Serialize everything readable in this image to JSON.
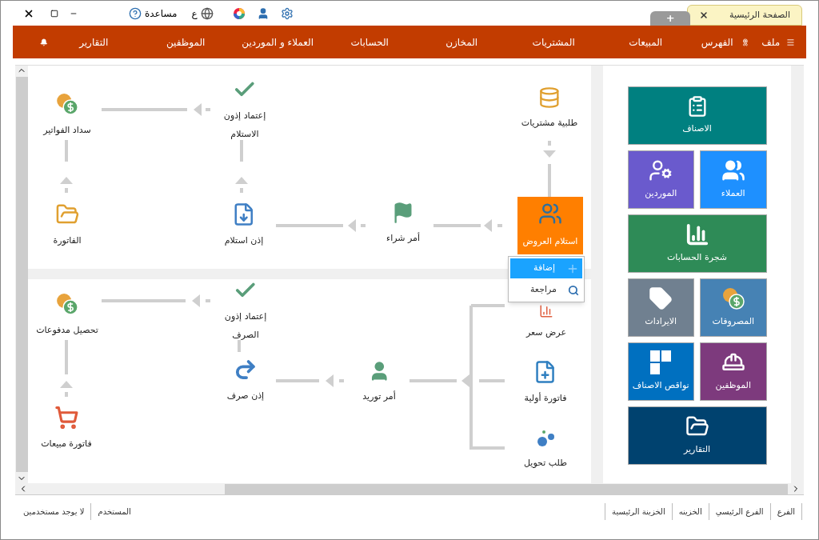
{
  "titlebar": {
    "tabs": [
      {
        "label": "الصفحة الرئيسية",
        "selected": true
      },
      {
        "label": "+",
        "selected": false
      }
    ],
    "help": "مساعدة",
    "language": "ع"
  },
  "menu": {
    "items": [
      "ملف",
      "الفهرس",
      "المبيعات",
      "المشتريات",
      "المخازن",
      "الحسابات",
      "العملاء و الموردين",
      "الموظفين",
      "التقارير"
    ]
  },
  "purchase_flow": {
    "nodes": [
      {
        "label": "طلبية مشتريات",
        "selected": false
      },
      {
        "label": "إعتماد إذون\nالاستلام",
        "selected": false
      },
      {
        "label": "سداد الفواتير",
        "selected": false
      },
      {
        "label": "استلام العروض",
        "selected": true
      },
      {
        "label": "أمر شراء",
        "selected": false
      },
      {
        "label": "إذن استلام",
        "selected": false
      },
      {
        "label": "الفاتورة",
        "selected": false
      }
    ]
  },
  "sales_flow": {
    "nodes": [
      {
        "label": "عرض سعر",
        "selected": false
      },
      {
        "label": "فاتورة أولية",
        "selected": false
      },
      {
        "label": "طلب تحويل",
        "selected": false
      },
      {
        "label": "أمر توريد",
        "selected": false
      },
      {
        "label": "إذن صرف",
        "selected": false
      },
      {
        "label": "إعتماد إذون\nالصرف",
        "selected": false
      },
      {
        "label": "تحصيل مدفوعات",
        "selected": false
      },
      {
        "label": "فاتورة مبيعات",
        "selected": false
      }
    ]
  },
  "context_menu": {
    "items": [
      {
        "label": "إضافة",
        "selected": true
      },
      {
        "label": "مراجعة",
        "selected": false
      }
    ]
  },
  "tiles": [
    {
      "label": "الاصناف",
      "kind": "wide",
      "color": "#008080"
    },
    {
      "label": "العملاء",
      "kind": "half",
      "color": "#1e90ff"
    },
    {
      "label": "الموردين",
      "kind": "half",
      "color": "#6a5acd"
    },
    {
      "label": "شجرة الحسابات",
      "kind": "wide",
      "color": "#2e8b57"
    },
    {
      "label": "المصروفات",
      "kind": "half",
      "color": "#4682b4"
    },
    {
      "label": "الايرادات",
      "kind": "half",
      "color": "#708090"
    },
    {
      "label": "الموظفين",
      "kind": "half",
      "color": "#7d3a7d"
    },
    {
      "label": "نواقص الاصناف",
      "kind": "half",
      "color": "#0070c0"
    },
    {
      "label": "التقارير",
      "kind": "wide",
      "color": "#00426f"
    }
  ],
  "status_bar": {
    "right": [
      "الفرع",
      "الفرع الرئيسي",
      "الخزينه",
      "الخزينة الرئيسية"
    ],
    "left": [
      "المستخدم",
      "لا يوجد مستخدمين"
    ]
  }
}
